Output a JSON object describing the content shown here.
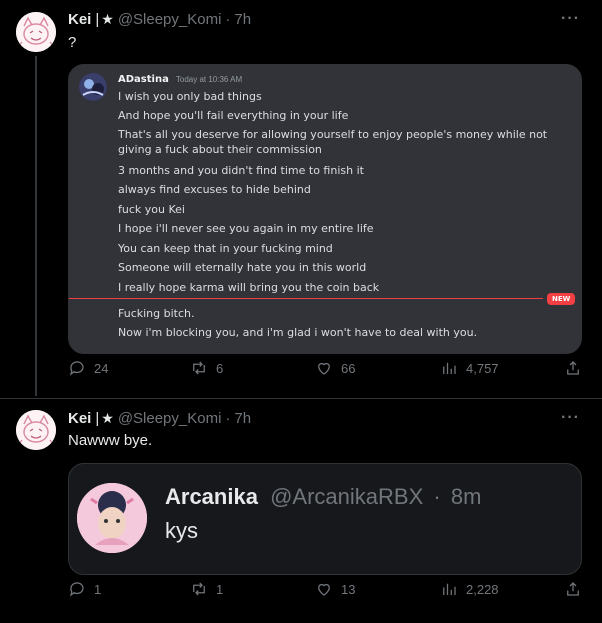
{
  "tweets": [
    {
      "author": {
        "name": "Kei",
        "separator": "|",
        "badge": "★",
        "handle": "@Sleepy_Komi",
        "time": "7h"
      },
      "text": "?",
      "media": {
        "type": "discord-screenshot",
        "username": "ADastina",
        "timestamp": "Today at 10:36 AM",
        "messages_before": [
          "I wish you only bad things",
          "And hope you'll fail everything in your life",
          "That's all you deserve for allowing yourself to enjoy people's money while not giving a fuck about their commission",
          "3 months and you didn't find time to finish it",
          "always find excuses to hide behind",
          "fuck you Kei",
          "I hope i'll never see you again in my entire life",
          "You can keep that in your fucking mind",
          "Someone will eternally hate you in this world",
          "I really hope karma will bring you the coin back"
        ],
        "new_badge": "NEW",
        "messages_after": [
          "Fucking bitch.",
          "Now i'm blocking you, and i'm glad i won't have to deal with you."
        ]
      },
      "actions": {
        "replies": "24",
        "retweets": "6",
        "likes": "66",
        "views": "4,757"
      }
    },
    {
      "author": {
        "name": "Kei",
        "separator": "|",
        "badge": "★",
        "handle": "@Sleepy_Komi",
        "time": "7h"
      },
      "text": "Nawww bye.",
      "quote": {
        "name": "Arcanika",
        "handle": "@ArcanikaRBX",
        "time": "8m",
        "text": "kys"
      },
      "actions": {
        "replies": "1",
        "retweets": "1",
        "likes": "13",
        "views": "2,228"
      }
    }
  ],
  "colors": {
    "background": "#000000",
    "text": "#e7e9ea",
    "muted": "#71767b",
    "discord_bg": "#313338",
    "new_red": "#f23f43"
  },
  "icons": [
    "reply-icon",
    "retweet-icon",
    "like-icon",
    "views-icon",
    "share-icon",
    "more-icon",
    "star-icon"
  ]
}
